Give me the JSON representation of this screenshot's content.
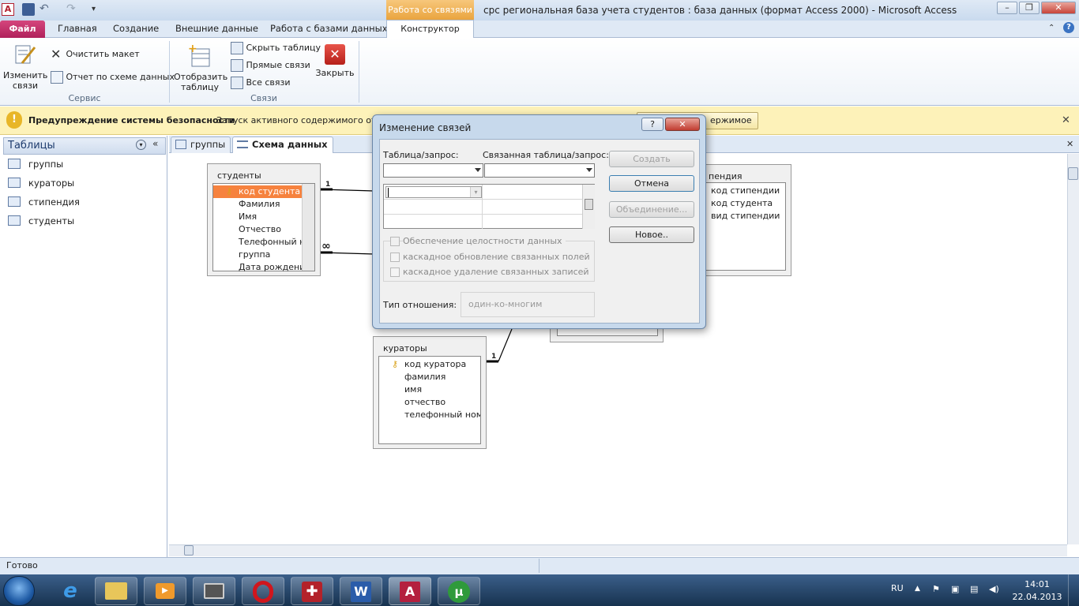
{
  "title_bar": {
    "context_group": "Работа со связями",
    "window_title": "срс региональная база учета студентов : база данных (формат Access 2000)  -  Microsoft Access"
  },
  "ribbon_tabs": {
    "file": "Файл",
    "home": "Главная",
    "create": "Создание",
    "external": "Внешние данные",
    "database_tools": "Работа с базами данных",
    "design": "Конструктор"
  },
  "ribbon": {
    "edit_relationships": "Изменить связи",
    "clear_layout": "Очистить макет",
    "relationship_report": "Отчет по схеме данных",
    "service_group": "Сервис",
    "show_table": "Отобразить таблицу",
    "hide_table": "Скрыть таблицу",
    "direct_relationships": "Прямые связи",
    "all_relationships": "Все связи",
    "close": "Закрыть",
    "relationships_group": "Связи"
  },
  "security_bar": {
    "title": "Предупреждение системы безопасности",
    "message": "Запуск активного содержимого откл",
    "button": "ержимое"
  },
  "nav_pane": {
    "header": "Таблицы",
    "items": [
      "группы",
      "кураторы",
      "стипендия",
      "студенты"
    ]
  },
  "doc_tabs": [
    "группы",
    "Схема данных"
  ],
  "tables": {
    "students": {
      "title": "студенты",
      "fields": [
        "код студента",
        "Фамилия",
        "Имя",
        "Отчество",
        "Телефонный но",
        "группа",
        "Дата рождения"
      ]
    },
    "stipend": {
      "title": "пендия",
      "fields": [
        "код стипендии",
        "код студента",
        "вид стипендии"
      ]
    },
    "curators": {
      "title": "кураторы",
      "fields": [
        "код куратора",
        "фамилия",
        "имя",
        "отчество",
        "телефонный номе"
      ]
    }
  },
  "rel_labels": {
    "one": "1",
    "many": "∞",
    "one2": "1"
  },
  "dialog": {
    "title": "Изменение связей",
    "table_label": "Таблица/запрос:",
    "related_label": "Связанная таблица/запрос:",
    "create": "Создать",
    "cancel": "Отмена",
    "join": "Объединение...",
    "new": "Новое..",
    "integrity": "Обеспечение целостности данных",
    "cascade_update": "каскадное обновление связанных полей",
    "cascade_delete": "каскадное удаление связанных записей",
    "rel_type_label": "Тип отношения:",
    "rel_type_value": "один-ко-многим",
    "help": "?",
    "close": "✕"
  },
  "status_bar": {
    "text": "Готово"
  },
  "taskbar": {
    "lang": "RU",
    "time": "14:01",
    "date": "22.04.2013"
  }
}
